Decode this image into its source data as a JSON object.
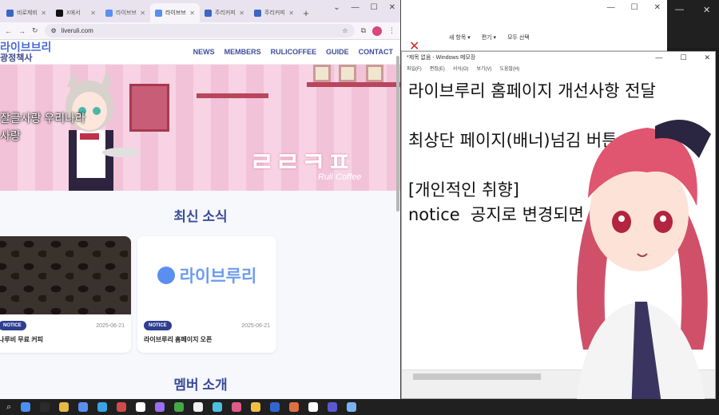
{
  "browser": {
    "tabs": [
      {
        "label": "비로제비",
        "color": "#3a66c4",
        "active": false
      },
      {
        "label": "X에서",
        "color": "#111111",
        "active": false
      },
      {
        "label": "라이브브",
        "color": "#5a8ef0",
        "active": false
      },
      {
        "label": "라이브브",
        "color": "#5a8ef0",
        "active": true
      },
      {
        "label": "주리커피",
        "color": "#3a66c4",
        "active": false
      },
      {
        "label": "주리커피",
        "color": "#3a66c4",
        "active": false
      }
    ],
    "new_tab": "+",
    "url": "liveruli.com"
  },
  "site": {
    "logo": "라이브브리",
    "logo_sub": "광정책사",
    "nav": [
      "NEWS",
      "MEMBERS",
      "RULICOFFEE",
      "GUIDE",
      "CONTACT"
    ],
    "overlay_line1": "잘글사랑 우리나라",
    "overlay_line2": "사랑",
    "hero_title": "ㄹㄹㅋㅍ",
    "hero_sub": "Ruli Coffee",
    "news_heading": "최신 소식",
    "cards": [
      {
        "badge": "NOTICE",
        "date": "2025-06-21",
        "title": "나루비 무료 커피"
      },
      {
        "badge": "NOTICE",
        "date": "2025-06-21",
        "title": "라이브루리 홈페이지 오픈",
        "logo": "라이브루리"
      }
    ],
    "member_heading": "멤버 소개"
  },
  "explorer": {
    "tool1": "새 항목 ▾",
    "tool2": "편기 ▾",
    "tool3": "모두 선택"
  },
  "notepad": {
    "title": "*제목 없음 - Windows 메모장",
    "menu": [
      "파일(F)",
      "편집(E)",
      "서식(O)",
      "보기(V)",
      "도움말(H)"
    ],
    "lines": [
      "라이브루리 홈페이지 개선사항 전달",
      "",
      "최상단 페이지(배너)넘김 버튼",
      "",
      "[개인적인 취향]",
      "notice  공지로 변경되면"
    ]
  },
  "taskbar_icons": [
    "#4c8ff0",
    "#2b2b2b",
    "#e8b844",
    "#5a8ef0",
    "#3aa3e6",
    "#d14b4b",
    "#ffffff",
    "#9a6ff0",
    "#44a844",
    "#f0f0f0",
    "#4cc0e0",
    "#e05a8a",
    "#f0c040",
    "#3366cc",
    "#e07040",
    "#ffffff",
    "#5a5ad0",
    "#7ab4f0"
  ]
}
